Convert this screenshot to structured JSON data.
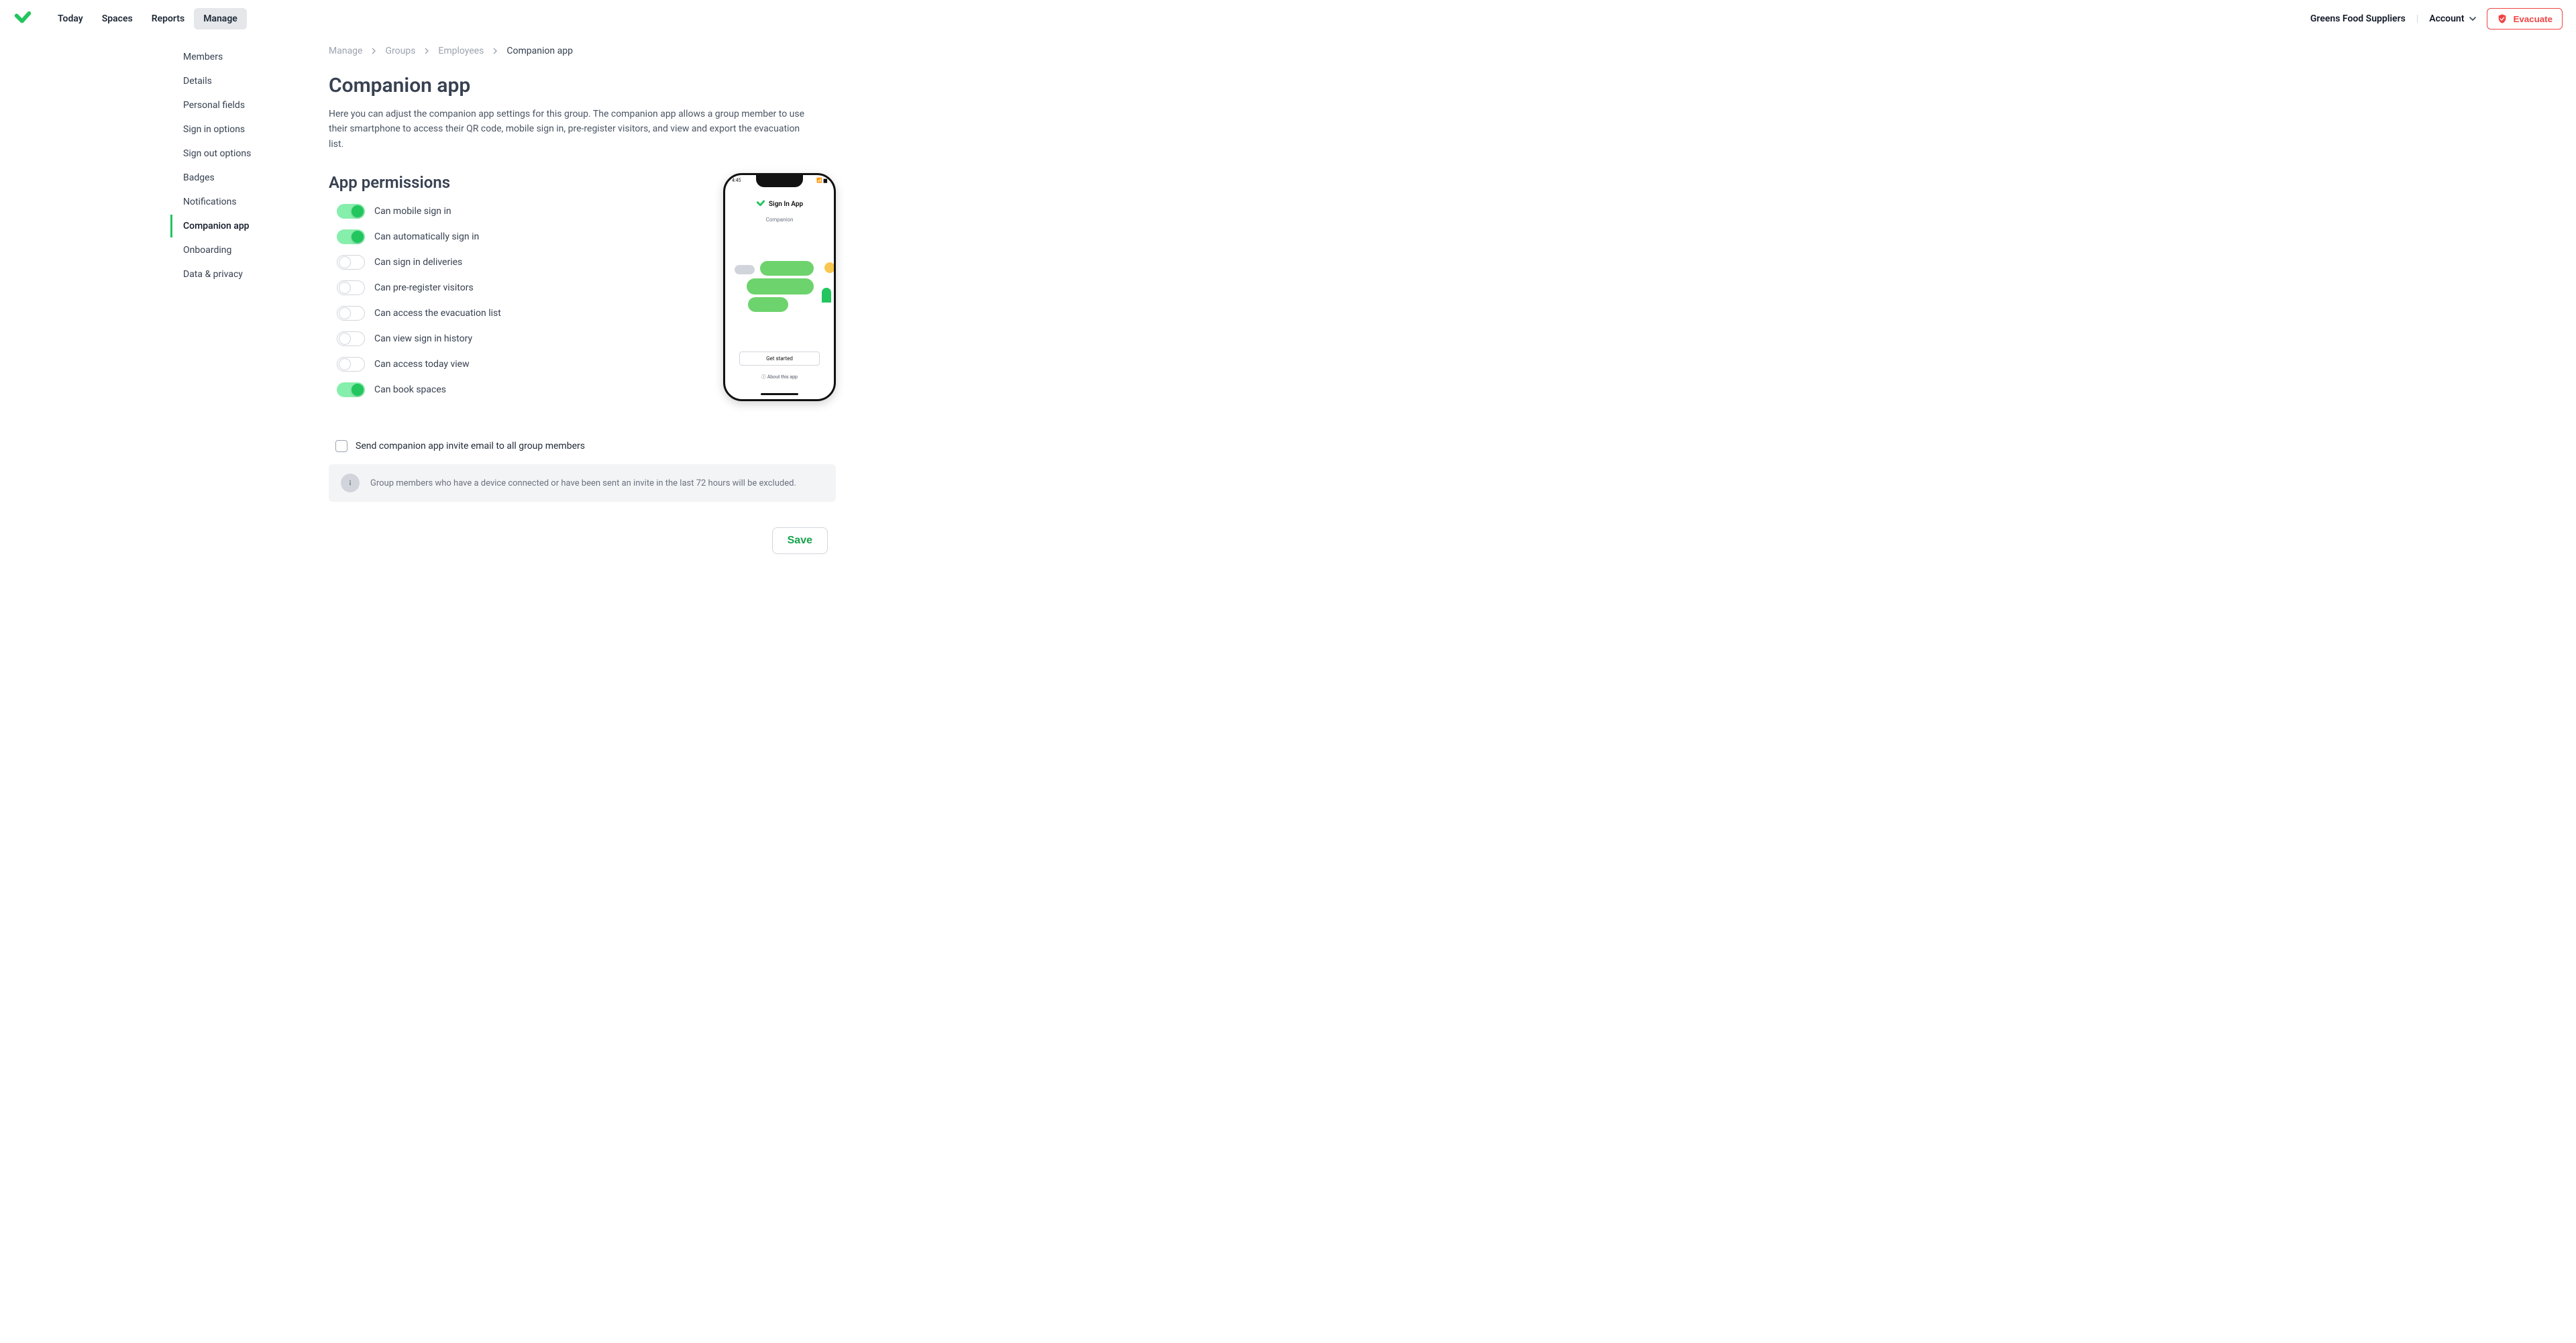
{
  "nav": {
    "items": [
      {
        "label": "Today",
        "active": false
      },
      {
        "label": "Spaces",
        "active": false
      },
      {
        "label": "Reports",
        "active": false
      },
      {
        "label": "Manage",
        "active": true
      }
    ]
  },
  "header": {
    "org_name": "Greens Food Suppliers",
    "account_label": "Account",
    "evacuate_label": "Evacuate"
  },
  "breadcrumb": {
    "items": [
      "Manage",
      "Groups",
      "Employees"
    ],
    "current": "Companion app"
  },
  "sidebar": {
    "items": [
      {
        "label": "Members",
        "active": false
      },
      {
        "label": "Details",
        "active": false
      },
      {
        "label": "Personal fields",
        "active": false
      },
      {
        "label": "Sign in options",
        "active": false
      },
      {
        "label": "Sign out options",
        "active": false
      },
      {
        "label": "Badges",
        "active": false
      },
      {
        "label": "Notifications",
        "active": false
      },
      {
        "label": "Companion app",
        "active": true
      },
      {
        "label": "Onboarding",
        "active": false
      },
      {
        "label": "Data & privacy",
        "active": false
      }
    ]
  },
  "page": {
    "title": "Companion app",
    "description": "Here you can adjust the companion app settings for this group. The companion app allows a group member to use their smartphone to access their QR code, mobile sign in, pre-register visitors, and view and export the evacuation list.",
    "permissions_title": "App permissions",
    "permissions": [
      {
        "label": "Can mobile sign in",
        "on": true
      },
      {
        "label": "Can automatically sign in",
        "on": true
      },
      {
        "label": "Can sign in deliveries",
        "on": false
      },
      {
        "label": "Can pre-register visitors",
        "on": false
      },
      {
        "label": "Can access the evacuation list",
        "on": false
      },
      {
        "label": "Can view sign in history",
        "on": false
      },
      {
        "label": "Can access today view",
        "on": false
      },
      {
        "label": "Can book spaces",
        "on": true
      }
    ],
    "invite_checkbox_label": "Send companion app invite email to all group members",
    "info_banner": "Group members who have a device connected or have been sent an invite in the last 72 hours will be excluded.",
    "save_label": "Save"
  },
  "phone": {
    "time": "4:45",
    "app_name": "Sign In App",
    "subtitle": "Companion",
    "cta": "Get started",
    "about": "ⓘ  About this app"
  }
}
